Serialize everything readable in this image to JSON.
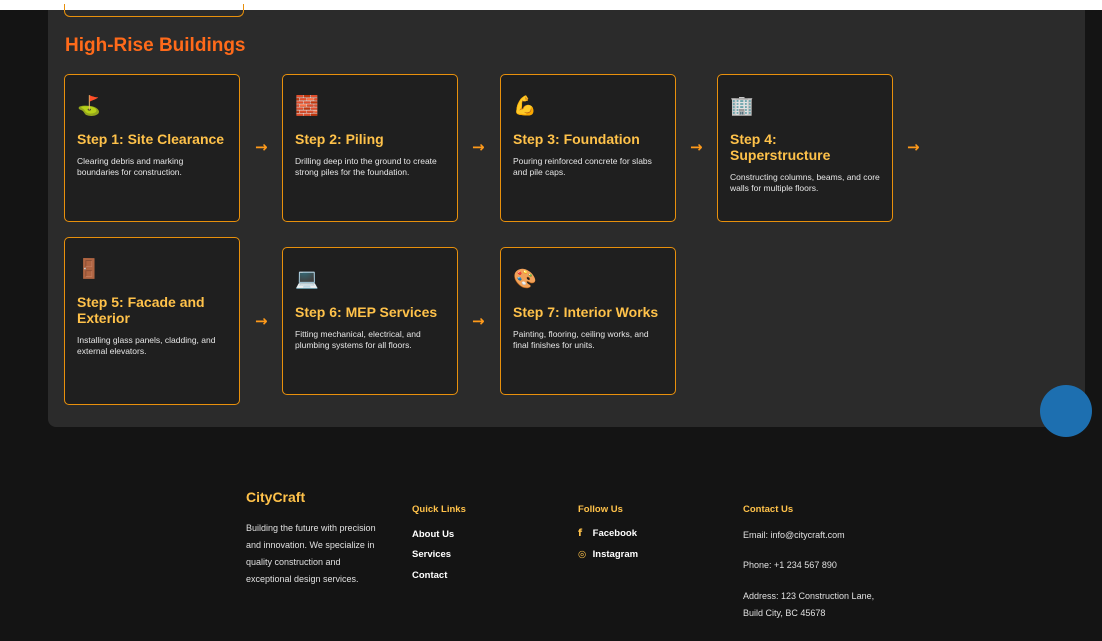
{
  "section": {
    "title": "High-Rise Buildings"
  },
  "steps": [
    {
      "icon": "golf-flag-icon",
      "glyph": "⛳",
      "title": "Step 1: Site Clearance",
      "desc": "Clearing debris and marking boundaries for construction."
    },
    {
      "icon": "bricks-icon",
      "glyph": "🧱",
      "title": "Step 2: Piling",
      "desc": "Drilling deep into the ground to create strong piles for the foundation."
    },
    {
      "icon": "flexed-arm-icon",
      "glyph": "💪",
      "title": "Step 3: Foundation",
      "desc": "Pouring reinforced concrete for slabs and pile caps."
    },
    {
      "icon": "office-building-icon",
      "glyph": "🏢",
      "title": "Step 4: Superstructure",
      "desc": "Constructing columns, beams, and core walls for multiple floors."
    },
    {
      "icon": "door-icon",
      "glyph": "🚪",
      "title": "Step 5: Facade and Exterior",
      "desc": "Installing glass panels, cladding, and external elevators."
    },
    {
      "icon": "laptop-icon",
      "glyph": "💻",
      "title": "Step 6: MEP Services",
      "desc": "Fitting mechanical, electrical, and plumbing systems for all floors."
    },
    {
      "icon": "artist-palette-icon",
      "glyph": "🎨",
      "title": "Step 7: Interior Works",
      "desc": "Painting, flooring, ceiling works, and final finishes for units."
    }
  ],
  "arrow_glyph": "→",
  "footer": {
    "brand": "CityCraft",
    "about": "Building the future with precision and innovation. We specialize in quality construction and exceptional design services.",
    "quick_links": {
      "heading": "Quick Links",
      "items": [
        "About Us",
        "Services",
        "Contact"
      ]
    },
    "follow": {
      "heading": "Follow Us",
      "items": [
        {
          "icon": "facebook-icon",
          "glyph": "f",
          "label": "Facebook"
        },
        {
          "icon": "instagram-icon",
          "glyph": "◎",
          "label": "Instagram"
        }
      ]
    },
    "contact": {
      "heading": "Contact Us",
      "email": "Email: info@citycraft.com",
      "phone": "Phone: +1 234 567 890",
      "address": "Address: 123 Construction Lane, Build City, BC 45678"
    }
  },
  "colors": {
    "accent_orange": "#ff6a1a",
    "card_border": "#e8900c",
    "step_title": "#ffc24a",
    "fab_blue": "#1d6fb0"
  }
}
